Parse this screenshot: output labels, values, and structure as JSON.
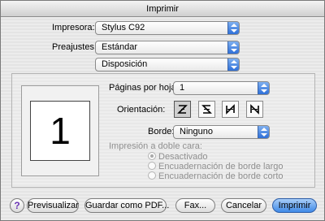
{
  "window": {
    "title": "Imprimir"
  },
  "printer": {
    "label": "Impresora:",
    "value": "Stylus C92"
  },
  "presets": {
    "label": "Preajustes:",
    "value": "Estándar"
  },
  "section": {
    "value": "Disposición"
  },
  "preview": {
    "page_number": "1"
  },
  "layout": {
    "pages_per_sheet_label": "Páginas por hoja:",
    "pages_per_sheet_value": "1",
    "orientation_label": "Orientación:",
    "orientation_options": [
      "Z",
      "S inverted",
      "N inverted",
      "N"
    ],
    "orientation_selected": 0,
    "border_label": "Borde:",
    "border_value": "Ninguno"
  },
  "duplex": {
    "label": "Impresión a doble cara:",
    "options": [
      "Desactivado",
      "Encuadernación de borde largo",
      "Encuadernación de borde corto"
    ],
    "selected": 0
  },
  "buttons": {
    "help": "?",
    "preview": "Previsualizar",
    "save_pdf": "Guardar como PDF...",
    "fax": "Fax...",
    "cancel": "Cancelar",
    "print": "Imprimir"
  },
  "colors": {
    "accent": "#3f8ae8",
    "help_icon": "#6a35b5"
  },
  "icons": {
    "help": "help-icon",
    "popup_arrows": "updown-arrows-icon"
  }
}
